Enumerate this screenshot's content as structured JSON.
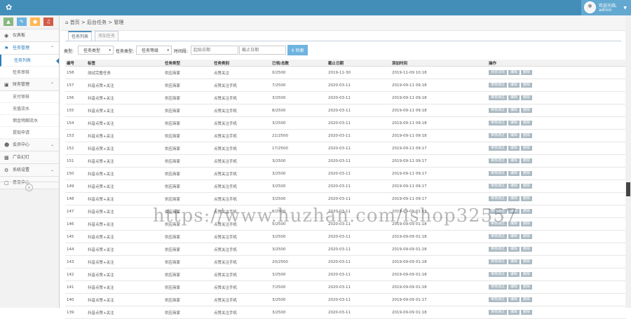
{
  "header": {
    "welcome": "欢迎光临,",
    "username": "admin",
    "colors": {
      "bar": "#438eb9",
      "user": "#62a8d1"
    }
  },
  "shortcuts": [
    {
      "icon": "signal-icon",
      "color": "#87b87f"
    },
    {
      "icon": "pencil-icon",
      "color": "#6fb3e0"
    },
    {
      "icon": "users-icon",
      "color": "#ffb752"
    },
    {
      "icon": "bell-icon",
      "color": "#d15b47"
    }
  ],
  "sidebar": {
    "dashboard": "仪表板",
    "task": {
      "label": "任务管理",
      "items": [
        "任务列表",
        "任务审核"
      ]
    },
    "finance": {
      "label": "财务管理",
      "items": [
        "支付审核",
        "充值流水",
        "佣金明细流水",
        "提现申请"
      ]
    },
    "member": "会员中心",
    "ads": "广告幻灯",
    "settings": "系统设置",
    "feedback": "意见中心"
  },
  "breadcrumb": {
    "home": "首页",
    "sep1": ">",
    "level2": "后台任务",
    "sep2": ">",
    "level3": "管理"
  },
  "tabs": [
    "任务列表",
    "添加任务"
  ],
  "filter": {
    "cat_label": "类型:",
    "cat_value": "任务类型",
    "type_label": "任务类型:",
    "type_value": "任务等级",
    "date_label": "时间段:",
    "start_placeholder": "起始日期",
    "end_placeholder": "截止日期",
    "search_label": "检索"
  },
  "table": {
    "columns": [
      "编号",
      "标签",
      "任务类型",
      "任务类别",
      "已领/总数",
      "截止日期",
      "添加时间",
      "操作"
    ],
    "rows": [
      [
        "158",
        "测试完整任务",
        "供应商家",
        "点赞关注",
        "0/2500",
        "2019-11-30",
        "2019-11-09 10:18"
      ],
      [
        "157",
        "抖音点赞+关注",
        "供应商家",
        "点赞关注手机",
        "7/2500",
        "2020-03-11",
        "2019-09-11 09:18"
      ],
      [
        "156",
        "抖音点赞+关注",
        "供应商家",
        "点赞关注手机",
        "3/2500",
        "2020-03-11",
        "2019-09-11 09:18"
      ],
      [
        "155",
        "抖音点赞+关注",
        "供应商家",
        "点赞关注手机",
        "8/2500",
        "2020-03-11",
        "2019-09-11 09:18"
      ],
      [
        "154",
        "抖音点赞+关注",
        "供应商家",
        "点赞关注手机",
        "3/2500",
        "2020-03-11",
        "2019-09-11 09:18"
      ],
      [
        "153",
        "抖音点赞+关注",
        "供应商家",
        "点赞关注手机",
        "21/2500",
        "2020-03-11",
        "2019-09-11 09:18"
      ],
      [
        "152",
        "抖音点赞+关注",
        "供应商家",
        "点赞关注手机",
        "17/2500",
        "2020-03-11",
        "2019-09-11 09:17"
      ],
      [
        "151",
        "抖音点赞+关注",
        "供应商家",
        "点赞关注手机",
        "3/2500",
        "2020-03-11",
        "2019-09-11 09:17"
      ],
      [
        "150",
        "抖音点赞+关注",
        "供应商家",
        "点赞关注手机",
        "3/2500",
        "2020-03-11",
        "2019-09-11 09:17"
      ],
      [
        "149",
        "抖音点赞+关注",
        "供应商家",
        "点赞关注手机",
        "3/2500",
        "2020-03-11",
        "2019-09-11 09:17"
      ],
      [
        "148",
        "抖音点赞+关注",
        "供应商家",
        "点赞关注手机",
        "3/2500",
        "2020-03-11",
        "2019-09-11 09:17"
      ],
      [
        "147",
        "抖音点赞+关注",
        "供应商家",
        "点赞关注手机",
        "6/2500",
        "2020-03-11",
        "2019-09-09 01:19"
      ],
      [
        "146",
        "抖音点赞+关注",
        "供应商家",
        "点赞关注手机",
        "5/2500",
        "2020-03-11",
        "2019-09-09 01:18"
      ],
      [
        "145",
        "抖音点赞+关注",
        "供应商家",
        "点赞关注手机",
        "3/2500",
        "2020-03-11",
        "2019-09-09 01:18"
      ],
      [
        "144",
        "抖音点赞+关注",
        "供应商家",
        "点赞关注手机",
        "3/2500",
        "2020-03-11",
        "2019-09-09 01:18"
      ],
      [
        "143",
        "抖音点赞+关注",
        "供应商家",
        "点赞关注手机",
        "20/2500",
        "2020-03-11",
        "2019-09-09 01:18"
      ],
      [
        "142",
        "抖音点赞+关注",
        "供应商家",
        "点赞关注手机",
        "3/2500",
        "2020-03-11",
        "2019-09-09 01:18"
      ],
      [
        "141",
        "抖音点赞+关注",
        "供应商家",
        "点赞关注手机",
        "7/2500",
        "2020-03-11",
        "2019-09-09 01:18"
      ],
      [
        "140",
        "抖音点赞+关注",
        "供应商家",
        "点赞关注手机",
        "3/2500",
        "2020-03-11",
        "2019-09-09 01:17"
      ],
      [
        "139",
        "抖音点赞+关注",
        "供应商家",
        "点赞关注手机",
        "3/2500",
        "2020-03-11",
        "2019-09-09 01:18"
      ]
    ],
    "actions_first": [
      "预览详情",
      "编辑",
      "删除"
    ],
    "actions": [
      "审核通过",
      "编辑",
      "删除"
    ]
  },
  "watermark": "https://www.huzhan.com/ishop32557"
}
